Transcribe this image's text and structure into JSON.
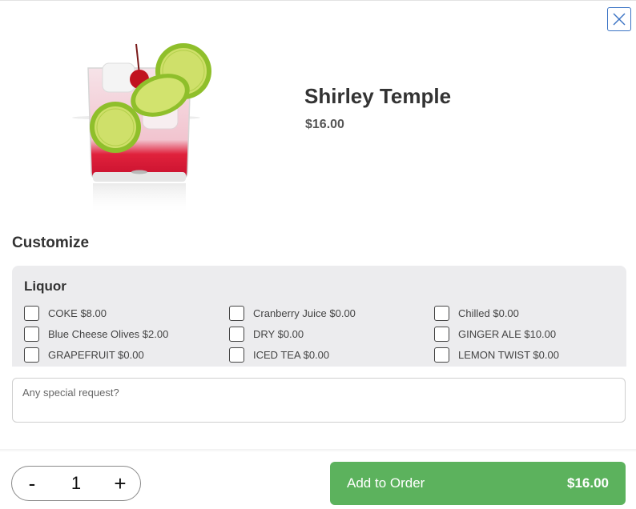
{
  "product": {
    "name": "Shirley Temple",
    "price": "$16.00"
  },
  "customize": {
    "title": "Customize",
    "group": {
      "title": "Liquor",
      "options": [
        {
          "label": "COKE $8.00",
          "checked": false
        },
        {
          "label": "Cranberry Juice $0.00",
          "checked": false
        },
        {
          "label": "Chilled $0.00",
          "checked": false
        },
        {
          "label": "Blue Cheese Olives $2.00",
          "checked": false
        },
        {
          "label": "DRY $0.00",
          "checked": false
        },
        {
          "label": "GINGER ALE $10.00",
          "checked": false
        },
        {
          "label": "GRAPEFRUIT $0.00",
          "checked": false
        },
        {
          "label": "ICED TEA $0.00",
          "checked": false
        },
        {
          "label": "LEMON TWIST $0.00",
          "checked": false
        }
      ]
    }
  },
  "special_request": {
    "placeholder": "Any special request?",
    "value": ""
  },
  "footer": {
    "decrement": "-",
    "quantity": "1",
    "increment": "+",
    "add_label": "Add to Order",
    "add_price": "$16.00"
  },
  "colors": {
    "accent_green": "#5cb25d",
    "close_blue": "#3a73c4",
    "group_bg": "#ececee"
  },
  "icons": {
    "close": "close-icon"
  }
}
